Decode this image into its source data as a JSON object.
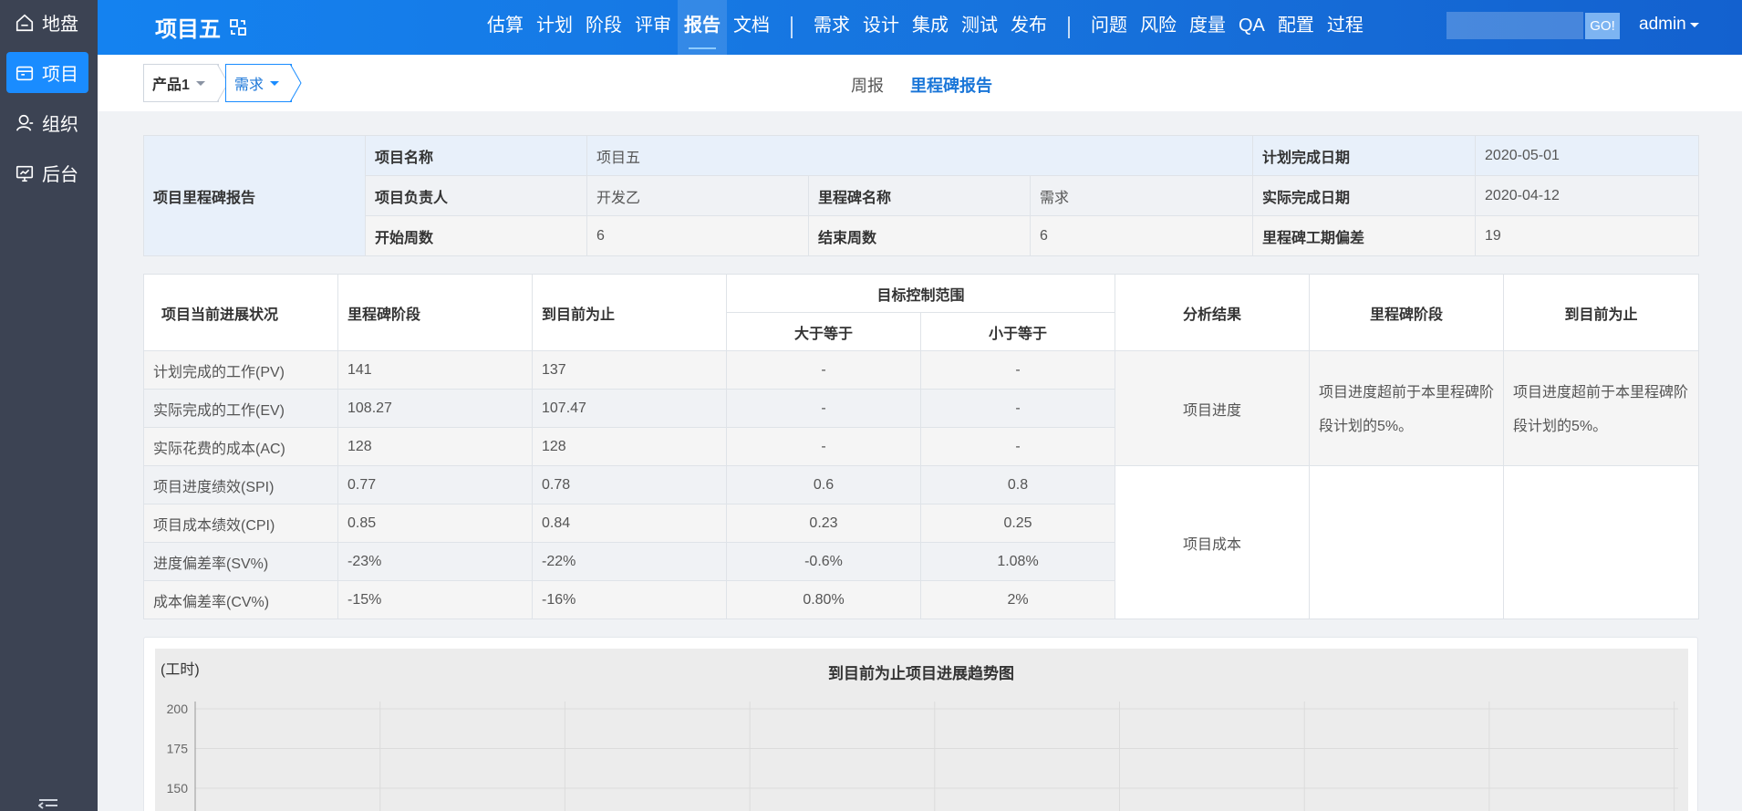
{
  "sidebar": {
    "items": [
      {
        "label": "地盘",
        "icon": "home-icon"
      },
      {
        "label": "项目",
        "icon": "project-icon"
      },
      {
        "label": "组织",
        "icon": "user-icon"
      },
      {
        "label": "后台",
        "icon": "monitor-icon"
      }
    ]
  },
  "header": {
    "title": "项目五",
    "nav_group1": [
      "估算",
      "计划",
      "阶段",
      "评审",
      "报告",
      "文档"
    ],
    "nav_group2": [
      "需求",
      "设计",
      "集成",
      "测试",
      "发布"
    ],
    "nav_group3": [
      "问题",
      "风险",
      "度量",
      "QA",
      "配置",
      "过程"
    ],
    "active_nav": "报告",
    "search_value": "",
    "go_label": "GO!",
    "user": "admin"
  },
  "subbar": {
    "crumb_product": "产品1",
    "crumb_stage": "需求",
    "tab_weekly": "周报",
    "tab_milestone": "里程碑报告"
  },
  "info": {
    "section_label": "项目里程碑报告",
    "project_name_label": "项目名称",
    "project_name": "项目五",
    "plan_finish_label": "计划完成日期",
    "plan_finish": "2020-05-01",
    "owner_label": "项目负责人",
    "owner": "开发乙",
    "milestone_name_label": "里程碑名称",
    "milestone_name": "需求",
    "actual_finish_label": "实际完成日期",
    "actual_finish": "2020-04-12",
    "start_week_label": "开始周数",
    "start_week": "6",
    "end_week_label": "结束周数",
    "end_week": "6",
    "deviation_label": "里程碑工期偏差",
    "deviation": "19"
  },
  "progress": {
    "headers": {
      "status": "项目当前进展状况",
      "milestone_stage": "里程碑阶段",
      "to_date": "到目前为止",
      "target_range": "目标控制范围",
      "gte": "大于等于",
      "lte": "小于等于",
      "analysis": "分析结果",
      "milestone_stage2": "里程碑阶段",
      "to_date2": "到目前为止"
    },
    "rows": [
      {
        "name": "计划完成的工作(PV)",
        "stage": "141",
        "to_date": "137",
        "gte": "-",
        "lte": "-"
      },
      {
        "name": "实际完成的工作(EV)",
        "stage": "108.27",
        "to_date": "107.47",
        "gte": "-",
        "lte": "-"
      },
      {
        "name": "实际花费的成本(AC)",
        "stage": "128",
        "to_date": "128",
        "gte": "-",
        "lte": "-"
      },
      {
        "name": "项目进度绩效(SPI)",
        "stage": "0.77",
        "to_date": "0.78",
        "gte": "0.6",
        "lte": "0.8"
      },
      {
        "name": "项目成本绩效(CPI)",
        "stage": "0.85",
        "to_date": "0.84",
        "gte": "0.23",
        "lte": "0.25"
      },
      {
        "name": "进度偏差率(SV%)",
        "stage": "-23%",
        "to_date": "-22%",
        "gte": "-0.6%",
        "lte": "1.08%"
      },
      {
        "name": "成本偏差率(CV%)",
        "stage": "-15%",
        "to_date": "-16%",
        "gte": "0.80%",
        "lte": "2%"
      }
    ],
    "analysis_schedule": "项目进度",
    "analysis_cost": "项目成本",
    "schedule_stage_result": "项目进度超前于本里程碑阶段计划的5%。",
    "schedule_to_date_result": "项目进度超前于本里程碑阶段计划的5%。"
  },
  "chart_data": {
    "type": "line",
    "title": "到目前为止项目进展趋势图",
    "ylabel": "(工时)",
    "yticks": [
      200,
      175,
      150
    ],
    "ylim": [
      150,
      200
    ],
    "grid": true,
    "series": []
  },
  "colors": {
    "accent": "#1a8cff",
    "sidebar": "#3c4353",
    "header_start": "#1482f0",
    "header_end": "#1361cf"
  }
}
